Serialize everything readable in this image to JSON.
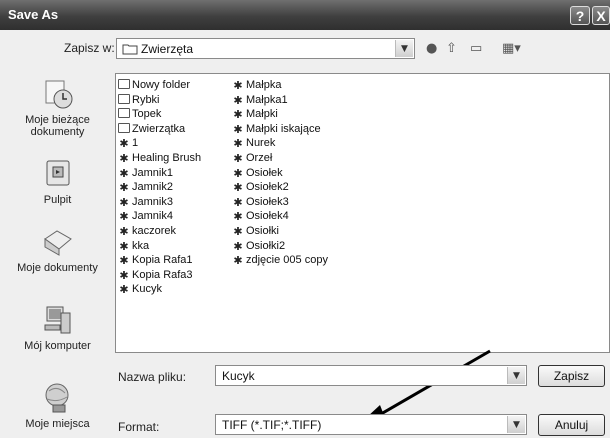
{
  "window": {
    "title": "Save As",
    "help_label": "?",
    "close_label": "X"
  },
  "location": {
    "label": "Zapisz w:",
    "current": "Zwierzęta"
  },
  "toolbar": {
    "icons": [
      "back-icon",
      "up-folder-icon",
      "new-folder-icon",
      "view-menu-icon"
    ]
  },
  "places": [
    {
      "label_lines": [
        "Moje bieżące",
        "dokumenty"
      ],
      "icon": "recent-documents-icon"
    },
    {
      "label_lines": [
        "Pulpit"
      ],
      "icon": "desktop-icon"
    },
    {
      "label_lines": [
        "Moje dokumenty"
      ],
      "icon": "my-documents-icon"
    },
    {
      "label_lines": [
        "Mój komputer"
      ],
      "icon": "my-computer-icon"
    },
    {
      "label_lines": [
        "Moje miejsca"
      ],
      "icon": "my-network-places-icon"
    }
  ],
  "files": {
    "column1": [
      {
        "name": "Nowy folder",
        "type": "folder"
      },
      {
        "name": "Rybki",
        "type": "folder"
      },
      {
        "name": "Topek",
        "type": "folder"
      },
      {
        "name": "Zwierzątka",
        "type": "folder"
      },
      {
        "name": "1",
        "type": "image"
      },
      {
        "name": "Healing Brush",
        "type": "image"
      },
      {
        "name": "Jamnik1",
        "type": "image"
      },
      {
        "name": "Jamnik2",
        "type": "image"
      },
      {
        "name": "Jamnik3",
        "type": "image"
      },
      {
        "name": "Jamnik4",
        "type": "image"
      },
      {
        "name": "kaczorek",
        "type": "image"
      },
      {
        "name": "kka",
        "type": "image"
      },
      {
        "name": "Kopia Rafa1",
        "type": "image"
      },
      {
        "name": "Kopia Rafa3",
        "type": "image"
      },
      {
        "name": "Kucyk",
        "type": "image"
      }
    ],
    "column2": [
      {
        "name": "Małpka",
        "type": "image"
      },
      {
        "name": "Małpka1",
        "type": "image"
      },
      {
        "name": "Małpki",
        "type": "image"
      },
      {
        "name": "Małpki iskające",
        "type": "image"
      },
      {
        "name": "Nurek",
        "type": "image"
      },
      {
        "name": "Orzeł",
        "type": "image"
      },
      {
        "name": "Osiołek",
        "type": "image"
      },
      {
        "name": "Osiołek2",
        "type": "image"
      },
      {
        "name": "Osiołek3",
        "type": "image"
      },
      {
        "name": "Osiołek4",
        "type": "image"
      },
      {
        "name": "Osiołki",
        "type": "image"
      },
      {
        "name": "Osiołki2",
        "type": "image"
      },
      {
        "name": "zdjęcie 005 copy",
        "type": "image"
      }
    ]
  },
  "filename": {
    "label": "Nazwa pliku:",
    "value": "Kucyk"
  },
  "format": {
    "label": "Format:",
    "value": "TIFF (*.TIF;*.TIFF)"
  },
  "buttons": {
    "save": "Zapisz",
    "cancel": "Anuluj"
  }
}
